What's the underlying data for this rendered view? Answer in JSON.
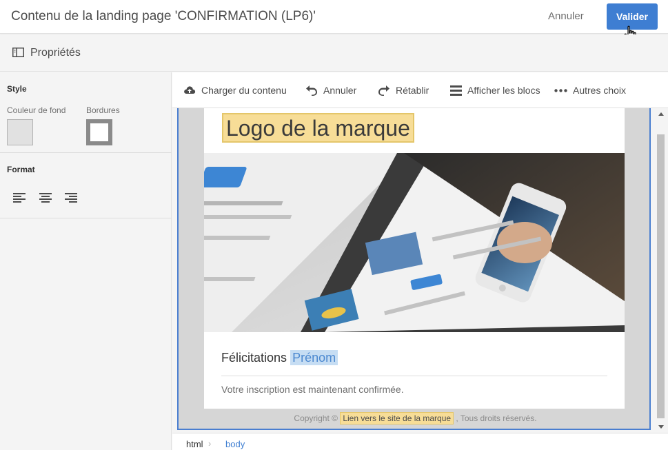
{
  "header": {
    "title": "Contenu de la landing page 'CONFIRMATION (LP6)'",
    "cancel_label": "Annuler",
    "validate_label": "Valider"
  },
  "properties_bar": {
    "label": "Propriétés",
    "icon": "panel-icon"
  },
  "sidebar": {
    "style": {
      "title": "Style",
      "background_color_label": "Couleur de fond",
      "borders_label": "Bordures"
    },
    "format": {
      "title": "Format",
      "align_icons": [
        "align-left-icon",
        "align-center-icon",
        "align-right-icon"
      ]
    }
  },
  "toolbar": {
    "items": [
      {
        "label": "Charger du contenu",
        "icon": "upload-cloud-icon"
      },
      {
        "label": "Annuler",
        "icon": "undo-icon"
      },
      {
        "label": "Rétablir",
        "icon": "redo-icon"
      },
      {
        "label": "Afficher les blocs",
        "icon": "blocks-icon"
      },
      {
        "label": "Autres choix",
        "icon": "more-icon"
      }
    ]
  },
  "email": {
    "logo_text": "Logo de la marque",
    "congrats_text": "Félicitations",
    "firstname_field": "Prénom",
    "confirmation_text": "Votre inscription est maintenant confirmée.",
    "footer_prefix": "Copyright ©",
    "footer_link": "Lien vers le site de la marque",
    "footer_suffix": ", Tous droits réservés."
  },
  "breadcrumb": {
    "items": [
      "html",
      "body"
    ]
  },
  "colors": {
    "accent": "#3e7ed2",
    "highlight_yellow": "#f7dd97",
    "highlight_blue": "#c6ddf3"
  }
}
